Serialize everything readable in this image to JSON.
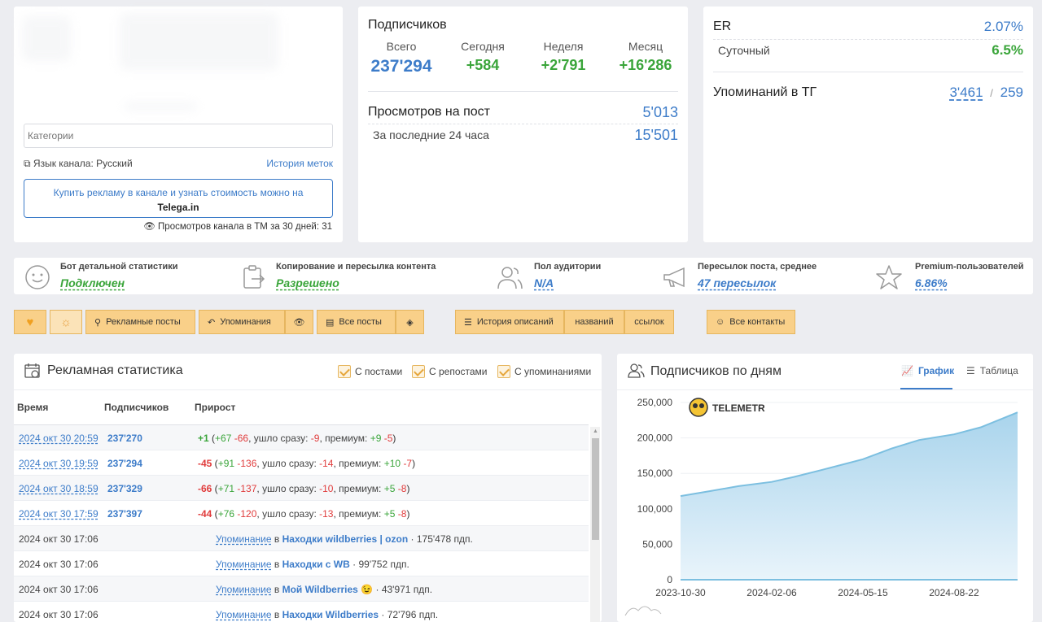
{
  "channel": {
    "categories_placeholder": "Категории",
    "language": "Язык канала: Русский",
    "label_history": "История меток",
    "buy_ads_text": "Купить рекламу в канале и узнать стоимость можно на",
    "buy_ads_link": "Telega.in",
    "views_tm": "Просмотров канала в ТМ за 30 дней: 31"
  },
  "subscribers": {
    "title": "Подписчиков",
    "total_label": "Всего",
    "total": "237'294",
    "today_label": "Сегодня",
    "today": "+584",
    "week_label": "Неделя",
    "week": "+2'791",
    "month_label": "Месяц",
    "month": "+16'286",
    "views_per_post_label": "Просмотров на пост",
    "views_per_post": "5'013",
    "last24_label": "За последние 24 часа",
    "last24": "15'501"
  },
  "er": {
    "er_label": "ER",
    "er": "2.07%",
    "daily_label": "Суточный",
    "daily": "6.5%",
    "mentions_label": "Упоминаний в ТГ",
    "mentions_a": "3'461",
    "mentions_sep": "/",
    "mentions_b": "259"
  },
  "features": [
    {
      "title": "Бот детальной статистики",
      "value": "Подключен",
      "icon": "smiley-icon",
      "color": "#3aa53a"
    },
    {
      "title": "Копирование и пересылка контента",
      "value": "Разрешено",
      "icon": "copy-forward-icon",
      "color": "#3aa53a"
    },
    {
      "title": "Пол аудитории",
      "value": "N/A",
      "icon": "users-icon",
      "color": "#3d7cc9"
    },
    {
      "title": "Пересылок поста, среднее",
      "value": "47 пересылок",
      "icon": "megaphone-icon",
      "color": "#3d7cc9"
    },
    {
      "title": "Premium-пользователей",
      "value": "6.86%",
      "icon": "star-icon",
      "color": "#3d7cc9"
    }
  ],
  "toolbar": {
    "ad_posts": "Рекламные посты",
    "mentions": "Упоминания",
    "all_posts": "Все посты",
    "desc_history": "История описаний",
    "names": "названий",
    "links": "ссылок",
    "all_contacts": "Все контакты"
  },
  "ad_stats": {
    "title": "Рекламная статистика",
    "chk_posts": "С постами",
    "chk_reposts": "С репостами",
    "chk_mentions": "С упоминаниями",
    "col_time": "Время",
    "col_subs": "Подписчиков",
    "col_growth": "Прирост",
    "rows": [
      {
        "time": "2024 окт 30 20:59",
        "subs": "237'270",
        "delta": "+1",
        "plus": "+67",
        "minus": "-66",
        "left_label": "ушло сразу:",
        "left": "-9",
        "prem_label": "премиум:",
        "prem_plus": "+9",
        "prem_minus": "-5"
      },
      {
        "time": "2024 окт 30 19:59",
        "subs": "237'294",
        "delta": "-45",
        "plus": "+91",
        "minus": "-136",
        "left_label": "ушло сразу:",
        "left": "-14",
        "prem_label": "премиум:",
        "prem_plus": "+10",
        "prem_minus": "-7"
      },
      {
        "time": "2024 окт 30 18:59",
        "subs": "237'329",
        "delta": "-66",
        "plus": "+71",
        "minus": "-137",
        "left_label": "ушло сразу:",
        "left": "-10",
        "prem_label": "премиум:",
        "prem_plus": "+5",
        "prem_minus": "-8"
      },
      {
        "time": "2024 окт 30 17:59",
        "subs": "237'397",
        "delta": "-44",
        "plus": "+76",
        "minus": "-120",
        "left_label": "ушло сразу:",
        "left": "-13",
        "prem_label": "премиум:",
        "prem_plus": "+5",
        "prem_minus": "-8"
      }
    ],
    "mentions": [
      {
        "time": "2024 окт 30 17:06",
        "label": "Упоминание",
        "in": "в",
        "channel": "Находки wildberries | ozon",
        "count": "· 175'478 пдп."
      },
      {
        "time": "2024 окт 30 17:06",
        "label": "Упоминание",
        "in": "в",
        "channel": "Находки с WB",
        "count": "· 99'752 пдп."
      },
      {
        "time": "2024 окт 30 17:06",
        "label": "Упоминание",
        "in": "в",
        "channel": "Мой Wildberries 😉",
        "count": "· 43'971 пдп."
      },
      {
        "time": "2024 окт 30 17:06",
        "label": "Упоминание",
        "in": "в",
        "channel": "Находки Wildberries",
        "count": "· 72'796 пдп."
      }
    ]
  },
  "subs_by_day": {
    "title": "Подписчиков по дням",
    "tab_chart": "График",
    "tab_table": "Таблица",
    "watermark": "TELEMETR"
  },
  "chart_data": {
    "type": "area",
    "x_ticks": [
      "2023-10-30",
      "2024-02-06",
      "2024-05-15",
      "2024-08-22"
    ],
    "y_ticks": [
      "0",
      "50,000",
      "100,000",
      "150,000",
      "200,000",
      "250,000"
    ],
    "ylim": [
      0,
      250000
    ],
    "x_start": "2023-10-30",
    "x_end": "2024-10-30",
    "series": [
      {
        "x": [
          "2023-10-30",
          "2023-12-01",
          "2024-01-01",
          "2024-02-06",
          "2024-03-01",
          "2024-04-01",
          "2024-05-15",
          "2024-06-15",
          "2024-07-15",
          "2024-08-22",
          "2024-09-20",
          "2024-10-30"
        ],
        "values": [
          118000,
          125000,
          132000,
          138000,
          145000,
          155000,
          170000,
          185000,
          197000,
          205000,
          215000,
          236000
        ]
      }
    ],
    "accent": "#7cbfe0"
  }
}
